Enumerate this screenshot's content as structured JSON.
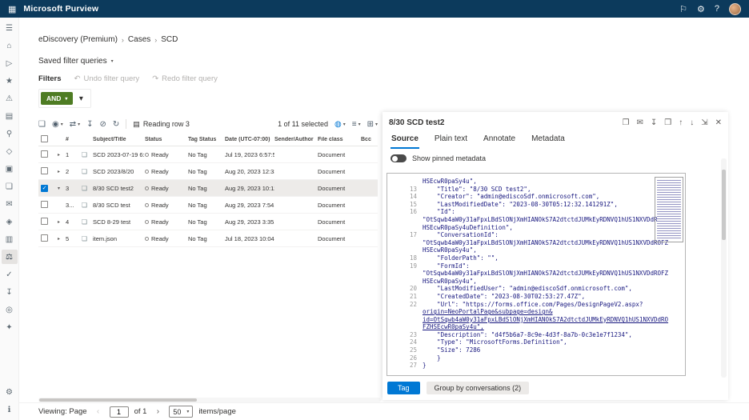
{
  "colors": {
    "accent": "#0078d4",
    "operator_green": "#4e7c23",
    "topbar": "#0c3a5c"
  },
  "icons": {
    "waffle": "▦",
    "megaphone": "⚐",
    "gear": "⚙",
    "help": "?",
    "chevdown": "▾",
    "chevright": "▸",
    "chevleft": "‹",
    "chevright2": "›",
    "undo": "↶",
    "redo": "↷",
    "doc": "❏",
    "eye": "◉",
    "swap": "⇄",
    "download": "↧",
    "erase": "⊘",
    "refresh": "↻",
    "rows": "▤",
    "globe": "◍",
    "list": "≡",
    "grid": "⊞",
    "open": "❐",
    "mail": "✉",
    "print": "❒",
    "up": "↑",
    "down": "↓",
    "expand": "⇲",
    "close": "✕",
    "check": "✓",
    "file": "❏",
    "menu": "☰",
    "home": "⌂",
    "tasks": "▷",
    "star": "★",
    "alert": "⚠",
    "report": "▤",
    "search": "⚲",
    "policy": "◇",
    "case": "▣",
    "content": "❏",
    "chat": "◈",
    "dataicon": "▥",
    "scales": "⚖",
    "audit": "✓",
    "export": "↧",
    "people": "◎",
    "keys": "✦",
    "info": "ℹ"
  },
  "topbar": {
    "title": "Microsoft Purview"
  },
  "rail": {
    "items": [
      {
        "name": "menu",
        "icon": "menu"
      },
      {
        "name": "home",
        "icon": "home"
      },
      {
        "name": "actions",
        "icon": "tasks"
      },
      {
        "name": "favorites",
        "icon": "star"
      },
      {
        "name": "alerts",
        "icon": "alert"
      },
      {
        "name": "reports",
        "icon": "report"
      },
      {
        "name": "search",
        "icon": "search"
      },
      {
        "name": "policies",
        "icon": "policy"
      },
      {
        "name": "cases",
        "icon": "case"
      },
      {
        "name": "content",
        "icon": "content"
      },
      {
        "name": "mail",
        "icon": "mail"
      },
      {
        "name": "communications",
        "icon": "chat"
      },
      {
        "name": "data",
        "icon": "dataicon"
      },
      {
        "name": "ediscovery",
        "icon": "scales",
        "active": true
      },
      {
        "name": "audit",
        "icon": "audit"
      },
      {
        "name": "export",
        "icon": "export"
      },
      {
        "name": "people",
        "icon": "people"
      },
      {
        "name": "permissions",
        "icon": "keys"
      }
    ],
    "bottom": [
      {
        "name": "settings",
        "icon": "gear"
      },
      {
        "name": "info",
        "icon": "info"
      }
    ]
  },
  "breadcrumb": {
    "items": [
      "eDiscovery (Premium)",
      "Cases",
      "SCD"
    ],
    "separator": "›"
  },
  "filters": {
    "saved_label": "Saved filter queries",
    "filters_label": "Filters",
    "undo_label": "Undo filter query",
    "redo_label": "Redo filter query",
    "operator": "AND"
  },
  "grid_toolbar": {
    "reading_label": "Reading row 3",
    "selection_label": "1 of 11 selected"
  },
  "table": {
    "headers": [
      "",
      "",
      "#",
      "",
      "Subject/Title",
      "Status",
      "Tag Status",
      "Date (UTC-07:00)",
      "Sender/Author",
      "File class",
      "Bcc"
    ],
    "rows": [
      {
        "num": "1",
        "subject": "SCD 2023-07-19 6:5...",
        "status": "Ready",
        "tag_status": "No Tag",
        "date": "Jul 19, 2023 6:57:56...",
        "sender": "",
        "file_class": "Document",
        "bcc": "",
        "selected": false,
        "expanded": false,
        "child": false
      },
      {
        "num": "2",
        "subject": "SCD 2023/8/20",
        "status": "Ready",
        "tag_status": "No Tag",
        "date": "Aug 20, 2023 12:33...",
        "sender": "",
        "file_class": "Document",
        "bcc": "",
        "selected": false,
        "expanded": false,
        "child": false
      },
      {
        "num": "3",
        "subject": "8/30 SCD test2",
        "status": "Ready",
        "tag_status": "No Tag",
        "date": "Aug 29, 2023 10:12...",
        "sender": "",
        "file_class": "Document",
        "bcc": "",
        "selected": true,
        "expanded": true,
        "child": false
      },
      {
        "num": "3...",
        "subject": "8/30 SCD test",
        "status": "Ready",
        "tag_status": "No Tag",
        "date": "Aug 29, 2023 7:54...",
        "sender": "",
        "file_class": "Document",
        "bcc": "",
        "selected": false,
        "expanded": false,
        "child": true
      },
      {
        "num": "4",
        "subject": "SCD 8-29 test",
        "status": "Ready",
        "tag_status": "No Tag",
        "date": "Aug 29, 2023 3:35...",
        "sender": "",
        "file_class": "Document",
        "bcc": "",
        "selected": false,
        "expanded": false,
        "child": false
      },
      {
        "num": "5",
        "subject": "item.json",
        "status": "Ready",
        "tag_status": "No Tag",
        "date": "Jul 18, 2023 10:04:3...",
        "sender": "",
        "file_class": "Document",
        "bcc": "",
        "selected": false,
        "expanded": false,
        "child": false
      }
    ]
  },
  "panel": {
    "title": "8/30 SCD test2",
    "tabs": [
      {
        "label": "Source",
        "active": true
      },
      {
        "label": "Plain text",
        "active": false
      },
      {
        "label": "Annotate",
        "active": false
      },
      {
        "label": "Metadata",
        "active": false
      }
    ],
    "toggle_label": "Show pinned metadata",
    "actions": {
      "tag": "Tag",
      "group": "Group by conversations (2)"
    }
  },
  "viewer": {
    "lines": [
      {
        "n": "",
        "t": "HSEcwR0paSy4u\","
      },
      {
        "n": "13",
        "t": "    \"Title\": \"8/30 SCD test2\","
      },
      {
        "n": "14",
        "t": "    \"Creator\": \"admin@ediscoSdf.onmicrosoft.com\","
      },
      {
        "n": "15",
        "t": "    \"LastModifiedDate\": \"2023-08-30T05:12:32.141291Z\","
      },
      {
        "n": "16",
        "t": "    \"Id\":"
      },
      {
        "n": "",
        "t": "\"OtSqwb4aW0y31aFpxLBdSlONjXmHIANOkS7A2dtctdJUMkEyRDNVQ1hUS1NXVDdROFZ"
      },
      {
        "n": "",
        "t": "HSEcwR0paSy4uDefinition\","
      },
      {
        "n": "17",
        "t": "    \"ConversationId\":"
      },
      {
        "n": "",
        "t": "\"OtSqwb4aW0y31aFpxLBdSlONjXmHIANOkS7A2dtctdJUMkEyRDNVQ1hUS1NXVDdROFZ"
      },
      {
        "n": "",
        "t": "HSEcwR0paSy4u\","
      },
      {
        "n": "18",
        "t": "    \"FolderPath\": \"\","
      },
      {
        "n": "19",
        "t": "    \"FormId\":"
      },
      {
        "n": "",
        "t": "\"OtSqwb4aW0y31aFpxLBdSlONjXmHIANOkS7A2dtctdJUMkEyRDNVQ1hUS1NXVDdROFZ"
      },
      {
        "n": "",
        "t": "HSEcwR0paSy4u\","
      },
      {
        "n": "20",
        "t": "    \"LastModifiedUser\": \"admin@ediscoSdf.onmicrosoft.com\","
      },
      {
        "n": "21",
        "t": "    \"CreatedDate\": \"2023-08-30T02:53:27.47Z\","
      },
      {
        "n": "22",
        "t": "    \"Url\": \"https://forms.office.com/Pages/DesignPageV2.aspx?"
      },
      {
        "n": "",
        "t": "origin=NeoPortalPage&subpage=design&",
        "link": true
      },
      {
        "n": "",
        "t": "id=OtSqwb4aW0y31aFpxLBdSlONjXmHIANOkS7A2dtctdJUMkEyRDNVQ1hUS1NXVDdRO",
        "link": true
      },
      {
        "n": "",
        "t": "FZHSEcwR0paSy4u\",",
        "link": true
      },
      {
        "n": "23",
        "t": "    \"Description\": \"d4f5b6a7-8c9e-4d3f-8a7b-0c3e1e7f1234\","
      },
      {
        "n": "24",
        "t": "    \"Type\": \"MicrosoftForms.Definition\","
      },
      {
        "n": "25",
        "t": "    \"Size\": 7286"
      },
      {
        "n": "26",
        "t": "    }"
      },
      {
        "n": "27",
        "t": "}"
      }
    ]
  },
  "pager": {
    "viewing_label": "Viewing: Page",
    "page": "1",
    "of_label": "of 1",
    "per_page": "50",
    "items_label": "items/page"
  }
}
